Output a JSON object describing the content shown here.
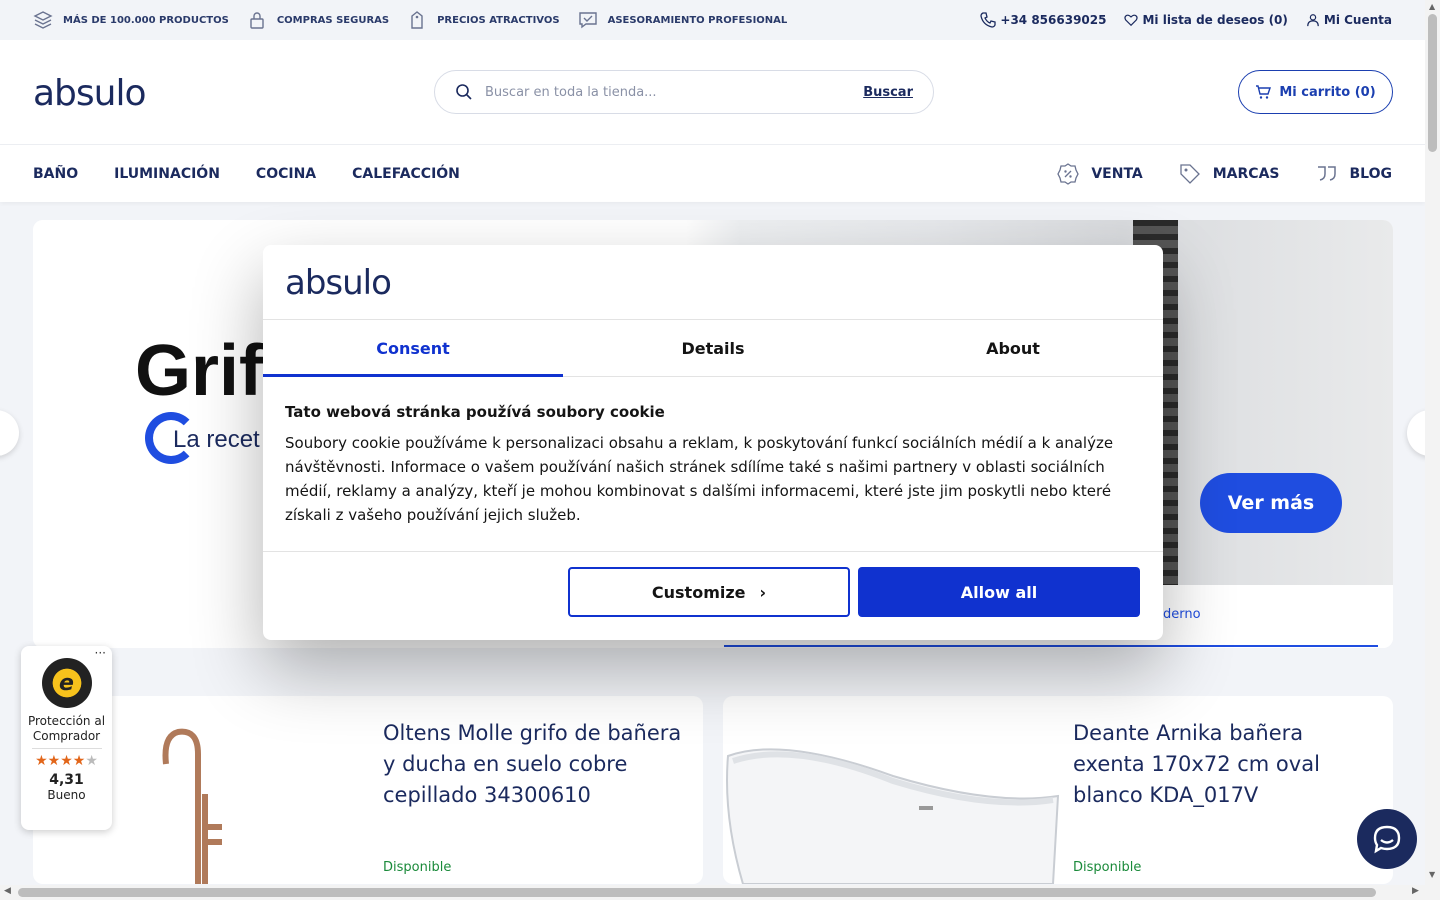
{
  "topbar": {
    "usps": [
      {
        "icon": "layers-icon",
        "label": "MÁS DE 100.000 PRODUCTOS"
      },
      {
        "icon": "lock-icon",
        "label": "COMPRAS SEGURAS"
      },
      {
        "icon": "price-tag-icon",
        "label": "PRECIOS ATRACTIVOS"
      },
      {
        "icon": "chat-check-icon",
        "label": "ASESORAMIENTO PROFESIONAL"
      }
    ],
    "phone": "+34 856639025",
    "wishlist": "Mi lista de deseos (0)",
    "account": "Mi Cuenta"
  },
  "header": {
    "logo": "absulo",
    "search_placeholder": "Buscar en toda la tienda...",
    "search_button": "Buscar",
    "cart": "Mi carrito (0)"
  },
  "nav": {
    "items": [
      "BAÑO",
      "ILUMINACIÓN",
      "COCINA",
      "CALEFACCIÓN"
    ],
    "right": [
      {
        "icon": "percent-badge-icon",
        "label": "VENTA"
      },
      {
        "icon": "tag-icon",
        "label": "MARCAS"
      },
      {
        "icon": "quote-icon",
        "label": "BLOG"
      }
    ]
  },
  "hero": {
    "title": "Grif",
    "subtitle": "La recet",
    "cta": "Ver más",
    "tab_label": "derno"
  },
  "products": [
    {
      "title": "Oltens Molle grifo de bañera y ducha en suelo cobre cepillado 34300610",
      "availability": "Disponible"
    },
    {
      "title": "Deante Arnika bañera exenta 170x72 cm oval blanco KDA_017V",
      "availability": "Disponible"
    }
  ],
  "trusted_shops": {
    "label": "Protección al Comprador",
    "rating": 4.31,
    "score": "4,31",
    "rating_text": "Bueno"
  },
  "cookie_modal": {
    "logo": "absulo",
    "tabs": [
      "Consent",
      "Details",
      "About"
    ],
    "active_tab": "Consent",
    "heading": "Tato webová stránka používá soubory cookie",
    "body": "Soubory cookie používáme k personalizaci obsahu a reklam, k poskytování funkcí sociálních médií a k analýze návštěvnosti. Informace o vašem používání našich stránek sdílíme také s našimi partnery v oblasti sociálních médií, reklamy a analýzy, kteří je mohou kombinovat s dalšími informacemi, které jste jim poskytli nebo které získali z vašeho používání jejich služeb.",
    "customize": "Customize",
    "allow_all": "Allow all"
  },
  "colors": {
    "brand_navy": "#1b2a5e",
    "accent_blue": "#1f4de0",
    "consent_blue": "#1032cf",
    "available_green": "#1a8a3a"
  }
}
